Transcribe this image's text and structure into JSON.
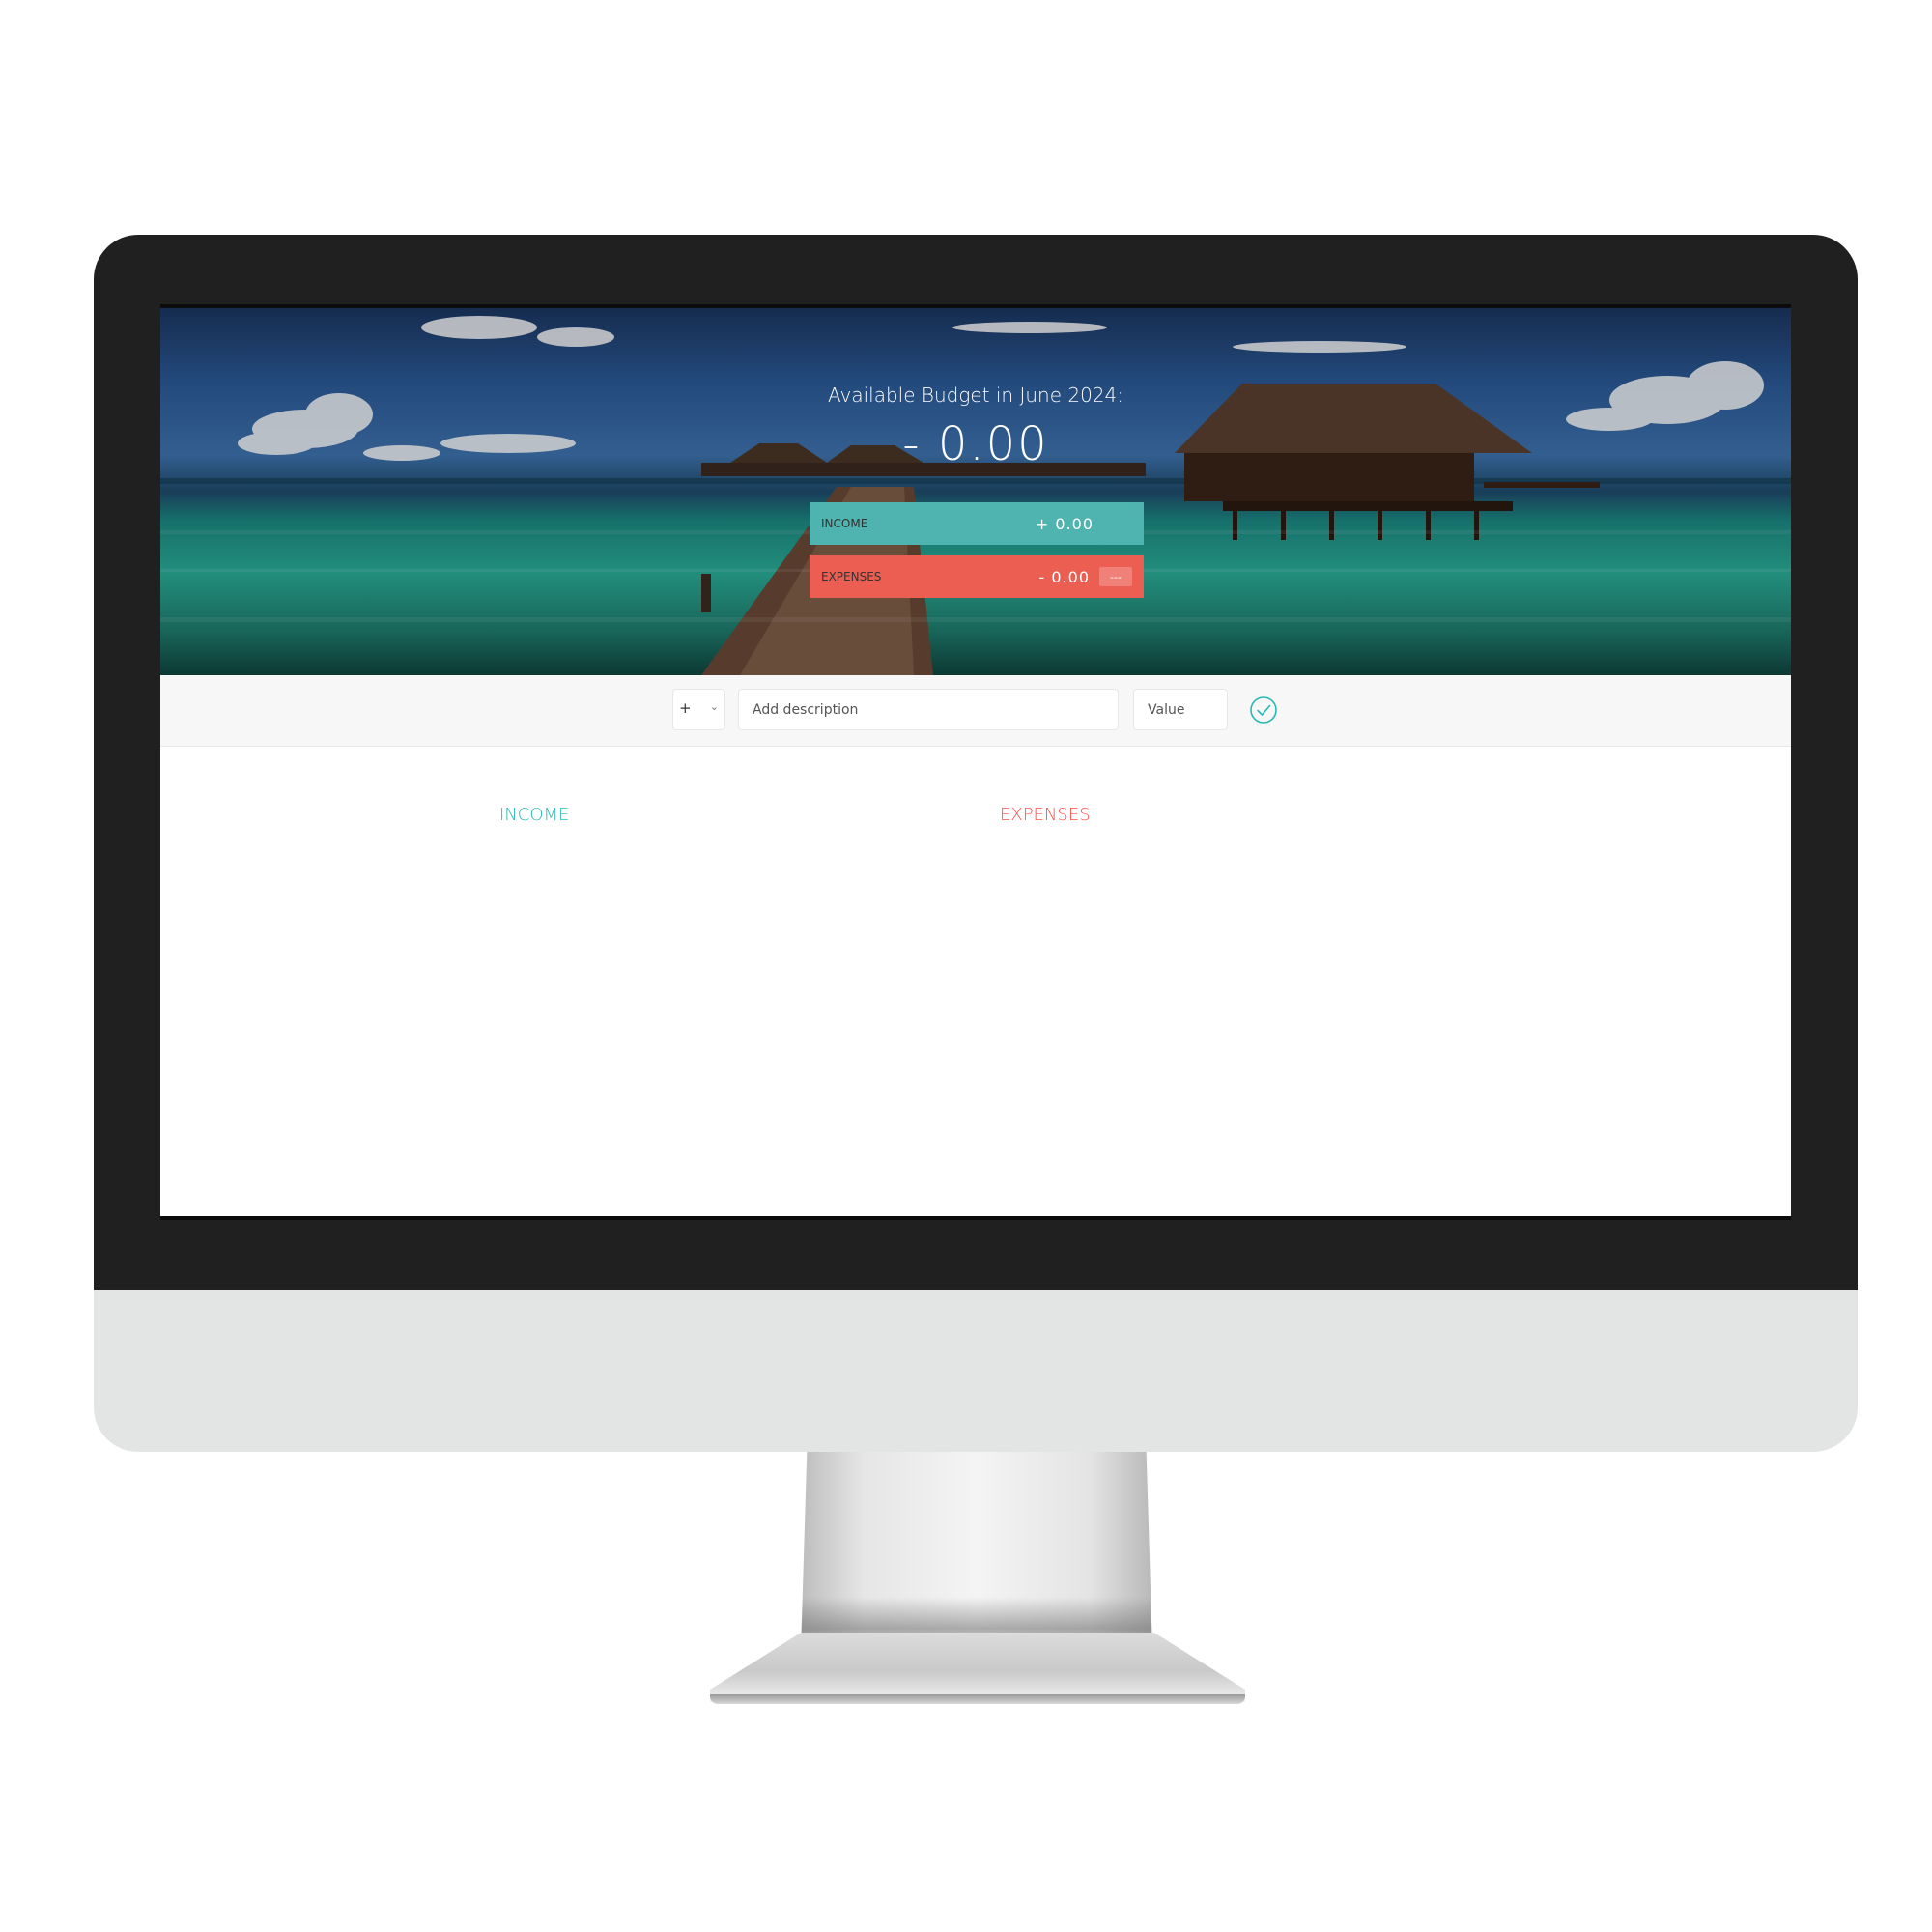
{
  "budget": {
    "title": "Available Budget in June 2024:",
    "value": "- 0.00"
  },
  "summary": {
    "income": {
      "label": "INCOME",
      "value": "+ 0.00"
    },
    "expenses": {
      "label": "EXPENSES",
      "value": "- 0.00",
      "percentage": "---"
    }
  },
  "add_form": {
    "type_value": "+",
    "description_placeholder": "Add description",
    "value_placeholder": "Value"
  },
  "lists": {
    "income_title": "INCOME",
    "expenses_title": "EXPENSES"
  },
  "colors": {
    "income": "#28b9b5",
    "expenses": "#ff5049",
    "income_bar": "#4fb3b0",
    "expenses_bar": "#ec5e52"
  }
}
